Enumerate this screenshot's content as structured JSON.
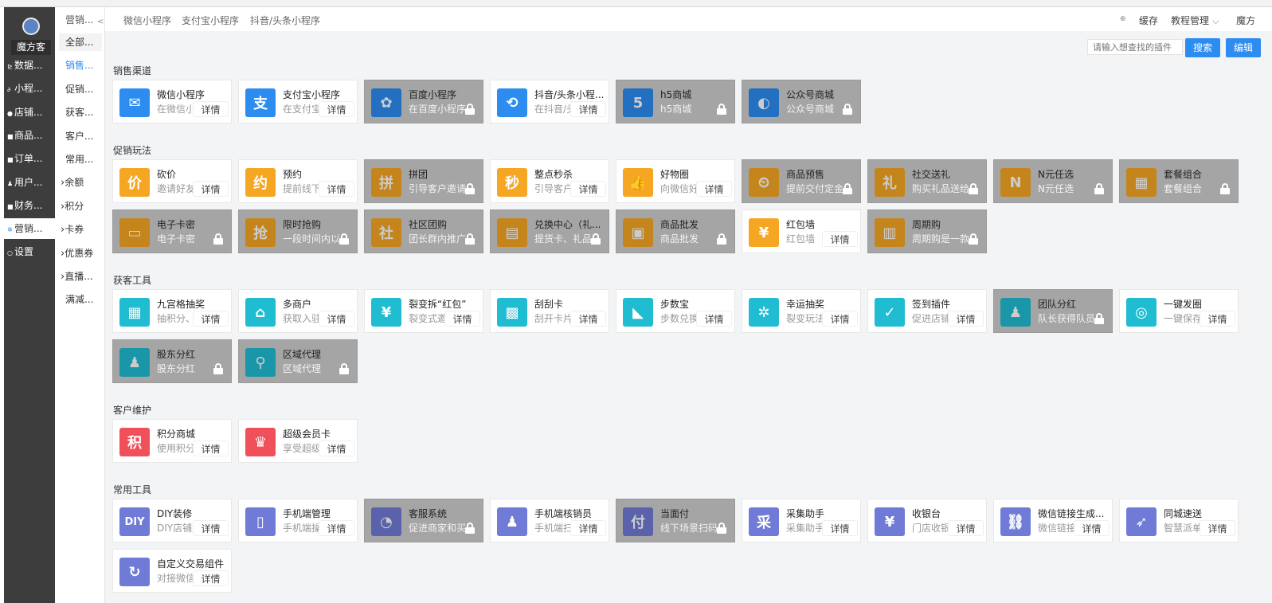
{
  "app": {
    "name": "魔方客"
  },
  "sidebar": {
    "items": [
      {
        "label": "数据...",
        "icon": "chart-icon"
      },
      {
        "label": "小程...",
        "icon": "link-icon"
      },
      {
        "label": "店铺...",
        "icon": "store-icon"
      },
      {
        "label": "商品...",
        "icon": "product-icon"
      },
      {
        "label": "订单...",
        "icon": "order-icon"
      },
      {
        "label": "用户...",
        "icon": "user-icon"
      },
      {
        "label": "财务...",
        "icon": "finance-icon"
      },
      {
        "label": "营销...",
        "icon": "marketing-icon",
        "active": true
      },
      {
        "label": "设置",
        "icon": "settings-icon"
      }
    ]
  },
  "subnav": {
    "title": "营销...",
    "items": [
      {
        "label": "全部..."
      },
      {
        "label": "销售..."
      },
      {
        "label": "促销..."
      },
      {
        "label": "获客..."
      },
      {
        "label": "客户..."
      },
      {
        "label": "常用..."
      },
      {
        "label": "余额"
      },
      {
        "label": "积分"
      },
      {
        "label": "卡券"
      },
      {
        "label": "优惠券"
      },
      {
        "label": "直播..."
      },
      {
        "label": "满减..."
      }
    ]
  },
  "topbar": {
    "tabs": [
      "微信小程序",
      "支付宝小程序",
      "抖音/头条小程序"
    ],
    "cache": "缓存",
    "tutorial": "教程管理",
    "user": "魔方"
  },
  "search": {
    "placeholder": "请输入想查找的插件",
    "button": "搜索",
    "edit": "编辑"
  },
  "detail_label": "详情",
  "sections": [
    {
      "title": "销售渠道",
      "cards": [
        {
          "title": "微信小程序",
          "desc": "在微信小程序",
          "locked": false,
          "color": "#2d8cf0",
          "glyph": "✉"
        },
        {
          "title": "支付宝小程序",
          "desc": "在支付宝小程序",
          "locked": false,
          "color": "#2d8cf0",
          "glyph": "支"
        },
        {
          "title": "百度小程序",
          "desc": "在百度小程序",
          "locked": true,
          "color": "#2d8cf0",
          "glyph": "✿"
        },
        {
          "title": "抖音/头条小程...",
          "desc": "在抖音/头条",
          "locked": false,
          "color": "#2d8cf0",
          "glyph": "⟲"
        },
        {
          "title": "h5商城",
          "desc": "h5商城",
          "locked": true,
          "color": "#2d8cf0",
          "glyph": "5"
        },
        {
          "title": "公众号商城",
          "desc": "公众号商城",
          "locked": true,
          "color": "#2d8cf0",
          "glyph": "◐"
        }
      ]
    },
    {
      "title": "促销玩法",
      "cards": [
        {
          "title": "砍价",
          "desc": "邀请好友砍价",
          "locked": false,
          "color": "#f5a623",
          "glyph": "价"
        },
        {
          "title": "预约",
          "desc": "提前线下预约",
          "locked": false,
          "color": "#f5a623",
          "glyph": "约"
        },
        {
          "title": "拼团",
          "desc": "引导客户邀请",
          "locked": true,
          "color": "#f5a623",
          "glyph": "拼"
        },
        {
          "title": "整点秒杀",
          "desc": "引导客户购买",
          "locked": false,
          "color": "#f5a623",
          "glyph": "秒"
        },
        {
          "title": "好物圈",
          "desc": "向微信好友",
          "locked": false,
          "color": "#f5a623",
          "glyph": "👍"
        },
        {
          "title": "商品预售",
          "desc": "提前交付定金",
          "locked": true,
          "color": "#f5a623",
          "glyph": "⏲"
        },
        {
          "title": "社交送礼",
          "desc": "购买礼品送给",
          "locked": true,
          "color": "#f5a623",
          "glyph": "礼"
        },
        {
          "title": "N元任选",
          "desc": "N元任选",
          "locked": true,
          "color": "#f5a623",
          "glyph": "N"
        },
        {
          "title": "套餐组合",
          "desc": "套餐组合",
          "locked": true,
          "color": "#f5a623",
          "glyph": "▦"
        },
        {
          "title": "电子卡密",
          "desc": "电子卡密",
          "locked": true,
          "color": "#f5a623",
          "glyph": "▭"
        },
        {
          "title": "限时抢购",
          "desc": "一段时间内以",
          "locked": true,
          "color": "#f5a623",
          "glyph": "抢"
        },
        {
          "title": "社区团购",
          "desc": "团长群内推广",
          "locked": true,
          "color": "#f5a623",
          "glyph": "社"
        },
        {
          "title": "兑换中心（礼...",
          "desc": "提货卡、礼品",
          "locked": true,
          "color": "#f5a623",
          "glyph": "▤"
        },
        {
          "title": "商品批发",
          "desc": "商品批发",
          "locked": true,
          "color": "#f5a623",
          "glyph": "▣"
        },
        {
          "title": "红包墙",
          "desc": "红包墙",
          "locked": false,
          "color": "#f5a623",
          "glyph": "¥"
        },
        {
          "title": "周期购",
          "desc": "周期购是一款",
          "locked": true,
          "color": "#f5a623",
          "glyph": "▥"
        }
      ]
    },
    {
      "title": "获客工具",
      "cards": [
        {
          "title": "九宫格抽奖",
          "desc": "抽积分、红包",
          "locked": false,
          "color": "#1fbcd2",
          "glyph": "▦"
        },
        {
          "title": "多商户",
          "desc": "获取入驻商户",
          "locked": false,
          "color": "#1fbcd2",
          "glyph": "⌂"
        },
        {
          "title": "裂变拆“红包”",
          "desc": "裂变式邀请",
          "locked": false,
          "color": "#1fbcd2",
          "glyph": "¥"
        },
        {
          "title": "刮刮卡",
          "desc": "刮开卡片",
          "locked": false,
          "color": "#1fbcd2",
          "glyph": "▩"
        },
        {
          "title": "步数宝",
          "desc": "步数兑换商品",
          "locked": false,
          "color": "#1fbcd2",
          "glyph": "◣"
        },
        {
          "title": "幸运抽奖",
          "desc": "裂变玩法",
          "locked": false,
          "color": "#1fbcd2",
          "glyph": "✲"
        },
        {
          "title": "签到插件",
          "desc": "促进店铺活跃",
          "locked": false,
          "color": "#1fbcd2",
          "glyph": "✓"
        },
        {
          "title": "团队分红",
          "desc": "队长获得队员",
          "locked": true,
          "color": "#1fbcd2",
          "glyph": "♟"
        },
        {
          "title": "一键发圈",
          "desc": "一键保存素材",
          "locked": false,
          "color": "#1fbcd2",
          "glyph": "◎"
        },
        {
          "title": "股东分红",
          "desc": "股东分红",
          "locked": true,
          "color": "#1fbcd2",
          "glyph": "♟"
        },
        {
          "title": "区域代理",
          "desc": "区域代理",
          "locked": true,
          "color": "#1fbcd2",
          "glyph": "⚲"
        }
      ]
    },
    {
      "title": "客户维护",
      "cards": [
        {
          "title": "积分商城",
          "desc": "使用积分兑换",
          "locked": false,
          "color": "#f0505a",
          "glyph": "积"
        },
        {
          "title": "超级会员卡",
          "desc": "享受超级会员",
          "locked": false,
          "color": "#f0505a",
          "glyph": "♛"
        }
      ]
    },
    {
      "title": "常用工具",
      "cards": [
        {
          "title": "DIY装修",
          "desc": "DIY店铺页面",
          "locked": false,
          "color": "#6f7bd6",
          "glyph": "DIY"
        },
        {
          "title": "手机端管理",
          "desc": "手机端操作",
          "locked": false,
          "color": "#6f7bd6",
          "glyph": "▯"
        },
        {
          "title": "客服系统",
          "desc": "促进商家和买家",
          "locked": true,
          "color": "#6f7bd6",
          "glyph": "◔"
        },
        {
          "title": "手机端核销员",
          "desc": "手机端扫码",
          "locked": false,
          "color": "#6f7bd6",
          "glyph": "♟"
        },
        {
          "title": "当面付",
          "desc": "线下场景扫码",
          "locked": true,
          "color": "#6f7bd6",
          "glyph": "付"
        },
        {
          "title": "采集助手",
          "desc": "采集助手",
          "locked": false,
          "color": "#6f7bd6",
          "glyph": "采"
        },
        {
          "title": "收银台",
          "desc": "门店收银",
          "locked": false,
          "color": "#6f7bd6",
          "glyph": "¥"
        },
        {
          "title": "微信链接生成...",
          "desc": "微信链接生成",
          "locked": false,
          "color": "#6f7bd6",
          "glyph": "⛓"
        },
        {
          "title": "同城速送",
          "desc": "智慧派单",
          "locked": false,
          "color": "#6f7bd6",
          "glyph": "➶"
        },
        {
          "title": "自定义交易组件",
          "desc": "对接微信交易",
          "locked": false,
          "color": "#6f7bd6",
          "glyph": "↻"
        }
      ]
    }
  ]
}
